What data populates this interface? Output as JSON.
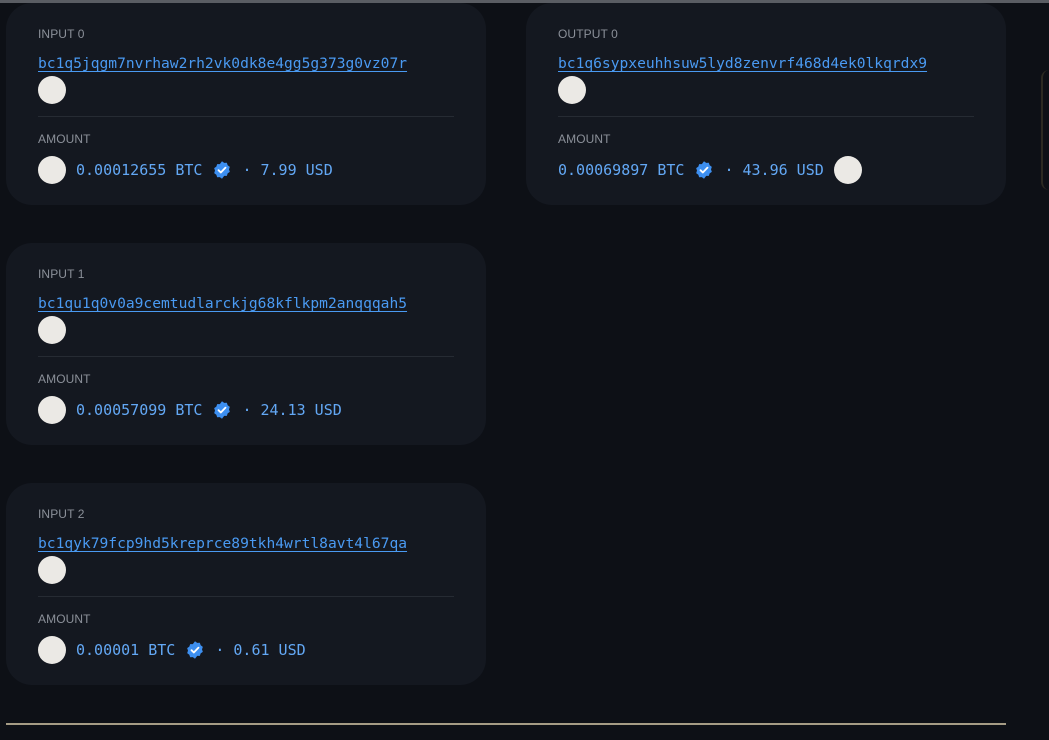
{
  "inputs": [
    {
      "label": "INPUT 0",
      "address": "bc1q5jqgm7nvrhaw2rh2vk0dk8e4gg5g373g0vz07r",
      "amount_label": "AMOUNT",
      "btc": "0.00012655 BTC",
      "usd": "· 7.99 USD"
    },
    {
      "label": "INPUT 1",
      "address": "bc1qu1q0v0a9cemtudlarckjg68kflkpm2anqqqah5",
      "amount_label": "AMOUNT",
      "btc": "0.00057099 BTC",
      "usd": "· 24.13 USD"
    },
    {
      "label": "INPUT 2",
      "address": "bc1qyk79fcp9hd5kreprce89tkh4wrtl8avt4l67qa",
      "amount_label": "AMOUNT",
      "btc": "0.00001 BTC",
      "usd": "· 0.61 USD"
    }
  ],
  "outputs": [
    {
      "label": "OUTPUT 0",
      "address": "bc1q6sypxeuhhsuw5lyd8zenvrf468d4ek0lkqrdx9",
      "amount_label": "AMOUNT",
      "btc": "0.00069897 BTC",
      "usd": "· 43.96 USD"
    }
  ],
  "icons": {
    "verified": "verified-check-icon",
    "avatar": "address-avatar-icon"
  },
  "colors": {
    "background": "#0d1016",
    "card": "#141820",
    "link": "#4a9af2",
    "amount": "#63a8f5",
    "verified": "#3d8ff0"
  }
}
